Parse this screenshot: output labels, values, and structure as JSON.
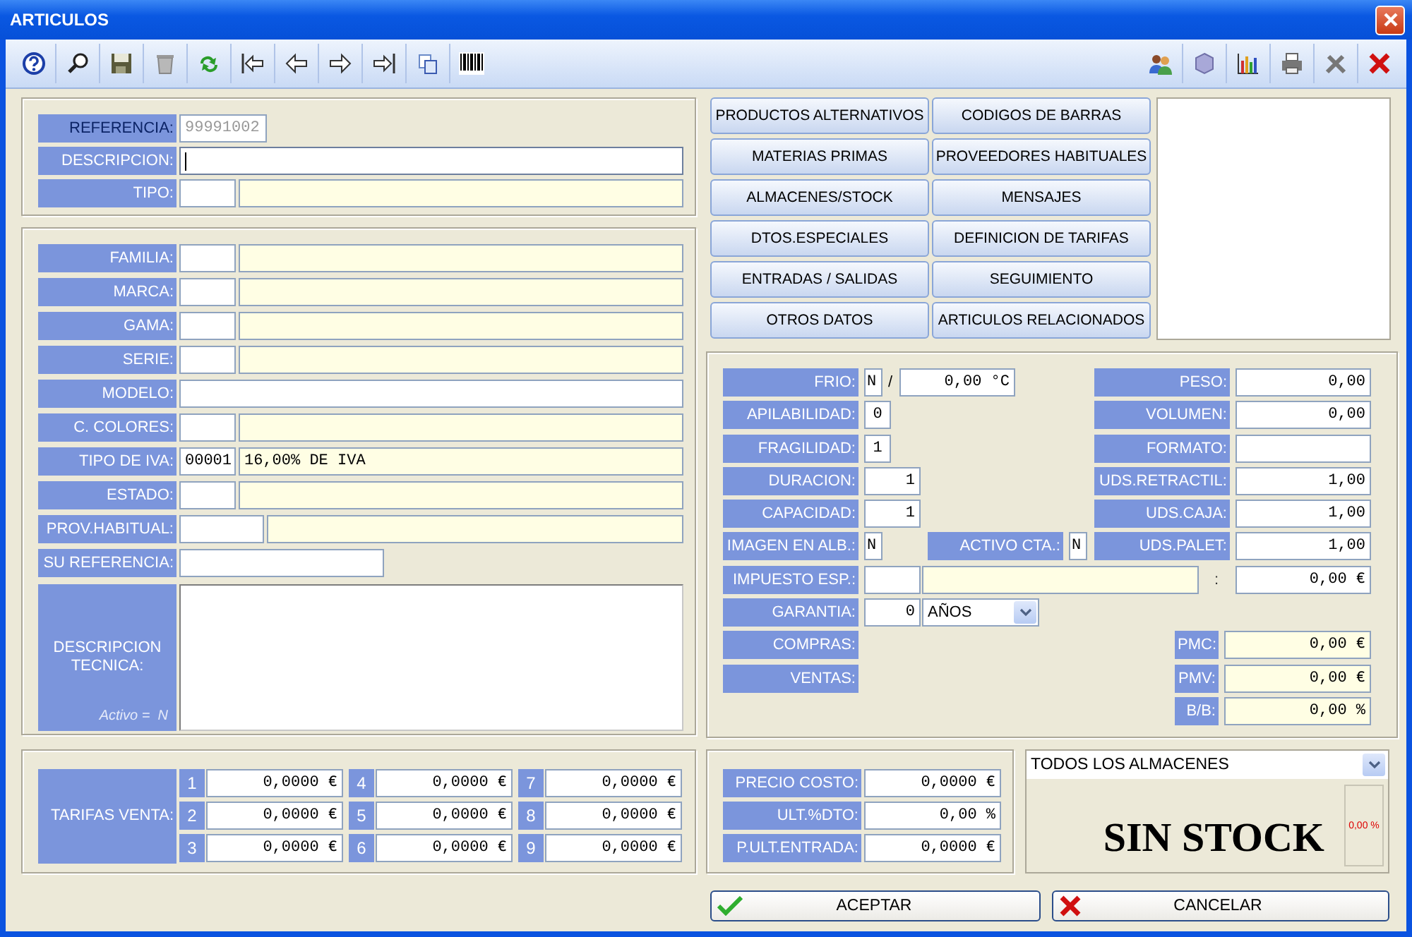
{
  "window": {
    "title": "ARTICULOS"
  },
  "header_fields": [
    {
      "label": "REFERENCIA:",
      "kind": "code",
      "value": "99991002",
      "emphasis": true,
      "focused": false
    },
    {
      "label": "DESCRIPCION:",
      "kind": "text",
      "emphasis": false,
      "focused": true
    },
    {
      "label": "TIPO:",
      "kind": "lookup",
      "emphasis": false,
      "focused": false
    }
  ],
  "detail_fields": [
    {
      "label": "FAMILIA:",
      "kind": "lookup"
    },
    {
      "label": "MARCA:",
      "kind": "lookup"
    },
    {
      "label": "GAMA:",
      "kind": "lookup"
    },
    {
      "label": "SERIE:",
      "kind": "lookup"
    },
    {
      "label": "MODELO:",
      "kind": "text"
    },
    {
      "label": "C. COLORES:",
      "kind": "lookup"
    },
    {
      "label": "TIPO DE IVA:",
      "kind": "lookup",
      "code": "00001",
      "value": "16,00% DE IVA"
    },
    {
      "label": "ESTADO:",
      "kind": "lookup"
    },
    {
      "label": "PROV.HABITUAL:",
      "kind": "lookup_wide"
    },
    {
      "label": "SU REFERENCIA:",
      "kind": "short"
    },
    {
      "label": "DESCRIPCION TECNICA:",
      "kind": "memo",
      "note": "Activo =  N"
    }
  ],
  "section_buttons": [
    "PRODUCTOS ALTERNATIVOS",
    "CODIGOS DE BARRAS",
    "MATERIAS PRIMAS",
    "PROVEEDORES HABITUALES",
    "ALMACENES/STOCK",
    "MENSAJES",
    "DTOS.ESPECIALES",
    "DEFINICION DE TARIFAS",
    "ENTRADAS / SALIDAS",
    "SEGUIMIENTO",
    "OTROS DATOS",
    "ARTICULOS RELACIONADOS"
  ],
  "properties": [
    {
      "left": [
        {
          "kind": "temperature",
          "label": "FRIO:",
          "flag": "N",
          "separator": "/",
          "value": "0,00 °C"
        }
      ],
      "right": {
        "kind": "value",
        "label": "PESO:",
        "value": "0,00"
      }
    },
    {
      "left": [
        {
          "kind": "digit",
          "label": "APILABILIDAD:",
          "value": "0"
        }
      ],
      "right": {
        "kind": "value",
        "label": "VOLUMEN:",
        "value": "0,00"
      }
    },
    {
      "left": [
        {
          "kind": "digit",
          "label": "FRAGILIDAD:",
          "value": "1"
        }
      ],
      "right": {
        "kind": "value",
        "label": "FORMATO:"
      }
    },
    {
      "left": [
        {
          "kind": "number",
          "label": "DURACION:",
          "value": "1"
        }
      ],
      "right": {
        "kind": "value",
        "label": "UDS.RETRACTIL:",
        "value": "1,00"
      }
    },
    {
      "left": [
        {
          "kind": "number",
          "label": "CAPACIDAD:",
          "value": "1"
        }
      ],
      "right": {
        "kind": "value",
        "label": "UDS.CAJA:",
        "value": "1,00"
      }
    },
    {
      "left": [
        {
          "kind": "flag",
          "label": "IMAGEN EN ALB.:",
          "value": "N"
        },
        {
          "kind": "flag",
          "label": "ACTIVO CTA.:",
          "value": "N"
        }
      ],
      "right": {
        "kind": "value",
        "label": "UDS.PALET:",
        "value": "1,00"
      }
    },
    {
      "left": [
        {
          "kind": "lookup",
          "label": "IMPUESTO ESP.:"
        }
      ],
      "right": {
        "kind": "amount",
        "separator": ":",
        "value": "0,00 €"
      }
    },
    {
      "left": [
        {
          "kind": "duration",
          "label": "GARANTIA:",
          "value": "0",
          "unit": "AÑOS"
        }
      ]
    },
    {
      "left": [
        {
          "kind": "label",
          "label": "COMPRAS:"
        }
      ],
      "right": {
        "kind": "computed",
        "label": "PMC:",
        "value": "0,00 €"
      }
    },
    {
      "left": [
        {
          "kind": "label",
          "label": "VENTAS:"
        }
      ],
      "right": {
        "kind": "computed",
        "label": "PMV:",
        "value": "0,00 €"
      }
    },
    {
      "right": {
        "kind": "computed",
        "label": "B/B:",
        "value": "0,00 %"
      }
    }
  ],
  "tarifas": {
    "label": "TARIFAS VENTA:",
    "rates": [
      {
        "number": "1",
        "value": "0,0000 €"
      },
      {
        "number": "2",
        "value": "0,0000 €"
      },
      {
        "number": "3",
        "value": "0,0000 €"
      },
      {
        "number": "4",
        "value": "0,0000 €"
      },
      {
        "number": "5",
        "value": "0,0000 €"
      },
      {
        "number": "6",
        "value": "0,0000 €"
      },
      {
        "number": "7",
        "value": "0,0000 €"
      },
      {
        "number": "8",
        "value": "0,0000 €"
      },
      {
        "number": "9",
        "value": "0,0000 €"
      }
    ]
  },
  "costs": [
    {
      "label": "PRECIO COSTO:",
      "value": "0,0000 €"
    },
    {
      "label": "ULT.%DTO:",
      "value": "0,00 %"
    },
    {
      "label": "P.ULT.ENTRADA:",
      "value": "0,0000 €"
    }
  ],
  "stock": {
    "warehouse": "TODOS LOS ALMACENES",
    "status": "SIN STOCK",
    "percent": "0,00 %"
  },
  "actions": [
    {
      "label": "ACEPTAR",
      "kind": "accept"
    },
    {
      "label": "CANCELAR",
      "kind": "cancel"
    }
  ]
}
